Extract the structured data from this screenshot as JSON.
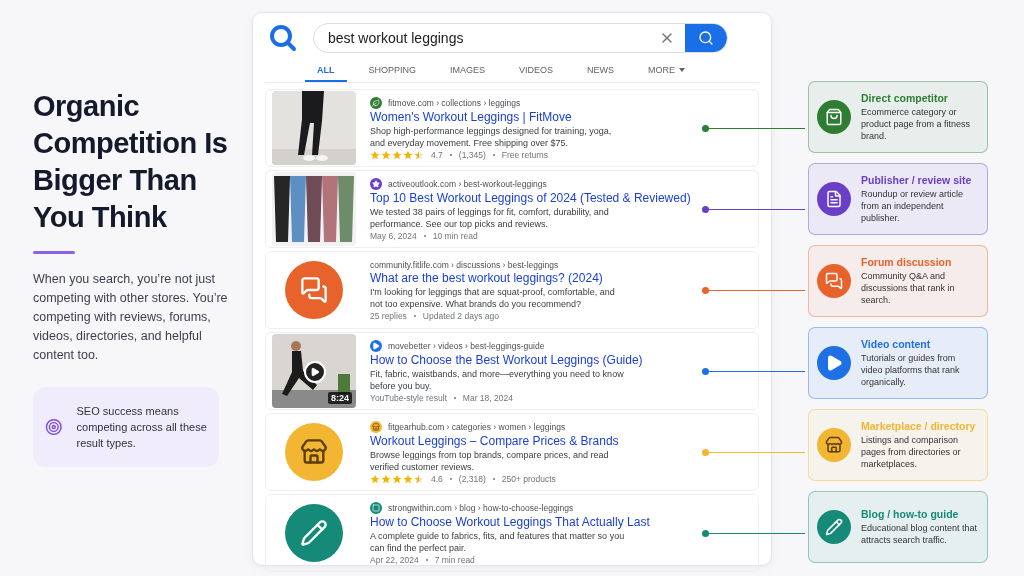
{
  "intro": {
    "title": "Organic Competition Is Bigger Than You Think",
    "body": "When you search, you’re not just competing with other stores. You’re competing with reviews, forums, videos, directories, and helpful content too.",
    "tip": "SEO success means competing across all these result types."
  },
  "search": {
    "query": "best workout leggings"
  },
  "tabs": [
    {
      "label": "ALL",
      "selected": true
    },
    {
      "label": "SHOPPING",
      "selected": false
    },
    {
      "label": "IMAGES",
      "selected": false
    },
    {
      "label": "VIDEOS",
      "selected": false
    },
    {
      "label": "NEWS",
      "selected": false
    },
    {
      "label": "MORE",
      "selected": false
    }
  ],
  "results": [
    {
      "kind": "product",
      "color": "#2e7d32",
      "breadcrumb": "fitmove.com › collections › leggings",
      "title": "Women's Workout Leggings | FitMove",
      "snippet": "Shop high-performance leggings designed for training, yoga, and everyday movement. Free shipping over $75.",
      "stars": 4.5,
      "meta": [
        "4.7",
        "(1,345)",
        "Free returns"
      ]
    },
    {
      "kind": "review",
      "color": "#6a3fc8",
      "breadcrumb": "activeoutlook.com › best-workout-leggings",
      "title": "Top 10 Best Workout Leggings of 2024 (Tested & Reviewed)",
      "snippet": "We tested 38 pairs of leggings for fit, comfort, durability, and performance. See our top picks and reviews.",
      "meta": [
        "May 6, 2024",
        "10 min read"
      ]
    },
    {
      "kind": "forum",
      "color": "#e8632b",
      "breadcrumb": "community.fitlife.com › discussions › best-leggings",
      "title": "What are the best workout leggings? (2024)",
      "snippet": "I'm looking for leggings that are squat-proof, comfortable, and not too expensive. What brands do you recommend?",
      "meta": [
        "25 replies",
        "Updated 2 days ago"
      ]
    },
    {
      "kind": "video",
      "color": "#1f6fe5",
      "duration": "8:24",
      "breadcrumb": "movebetter › videos › best-leggings-guide",
      "title": "How to Choose the Best Workout Leggings (Guide)",
      "snippet": "Fit, fabric, waistbands, and more—everything you need to know before you buy.",
      "meta": [
        "YouTube-style result",
        "Mar 18, 2024"
      ]
    },
    {
      "kind": "marketplace",
      "color": "#f2b632",
      "breadcrumb": "fitgearhub.com › categories › women › leggings",
      "title": "Workout Leggings – Compare Prices & Brands",
      "snippet": "Browse leggings from top brands, compare prices, and read verified customer reviews.",
      "stars": 4.5,
      "meta": [
        "4.6",
        "(2,318)",
        "250+ products"
      ]
    },
    {
      "kind": "blog",
      "color": "#158a78",
      "breadcrumb": "strongwithin.com › blog › how-to-choose-leggings",
      "title": "How to Choose Workout Leggings That Actually Last",
      "snippet": "A complete guide to fabrics, fits, and features that matter so you can find the perfect pair.",
      "meta": [
        "Apr 22, 2024",
        "7 min read"
      ]
    }
  ],
  "callouts": [
    {
      "kind": "product",
      "color": "#2e7d32",
      "title": "Direct competitor",
      "text": "Ecommerce category or product page from a fitness brand."
    },
    {
      "kind": "review",
      "color": "#6a3fc8",
      "title": "Publisher / review site",
      "text": "Roundup or review article from an independent publisher."
    },
    {
      "kind": "forum",
      "color": "#e8632b",
      "title": "Forum discussion",
      "text": "Community Q&A and discussions that rank in search."
    },
    {
      "kind": "video",
      "color": "#1f6fe5",
      "title": "Video content",
      "text": "Tutorials or guides from video platforms that rank organically."
    },
    {
      "kind": "marketplace",
      "color": "#f2b632",
      "title": "Marketplace / directory",
      "text": "Listings and comparison pages from directories or marketplaces."
    },
    {
      "kind": "blog",
      "color": "#158a78",
      "title": "Blog / how-to guide",
      "text": "Educational blog content that attracts search traffic."
    }
  ]
}
